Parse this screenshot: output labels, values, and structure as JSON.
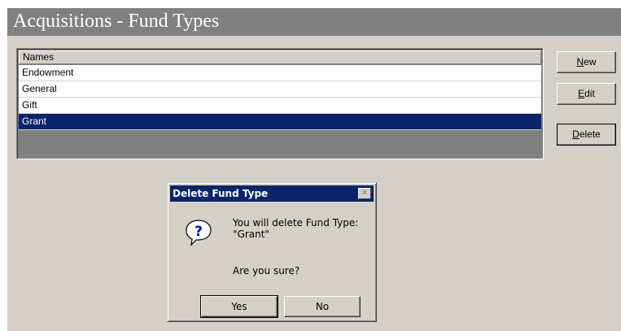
{
  "window": {
    "title": "Acquisitions  - Fund Types",
    "background": "#d4d0c8",
    "titlebar_color": "#808080"
  },
  "list": {
    "column_header": "Names",
    "rows": [
      "Endowment",
      "General",
      "Gift",
      "Grant"
    ],
    "selected_row": "Grant",
    "selection_color": "#0a246a"
  },
  "buttons": {
    "new": {
      "mnemonic": "N",
      "rest": "ew"
    },
    "edit": {
      "mnemonic": "E",
      "rest": "dit"
    },
    "delete": {
      "mnemonic": "D",
      "rest": "elete"
    }
  },
  "dialog": {
    "title": "Delete Fund Type",
    "close_glyph": "✕",
    "icon": "question-icon",
    "message_line1": "You will delete Fund Type:",
    "message_line2": "\"Grant\"",
    "confirm": "Are you sure?",
    "yes": "Yes",
    "no": "No"
  }
}
